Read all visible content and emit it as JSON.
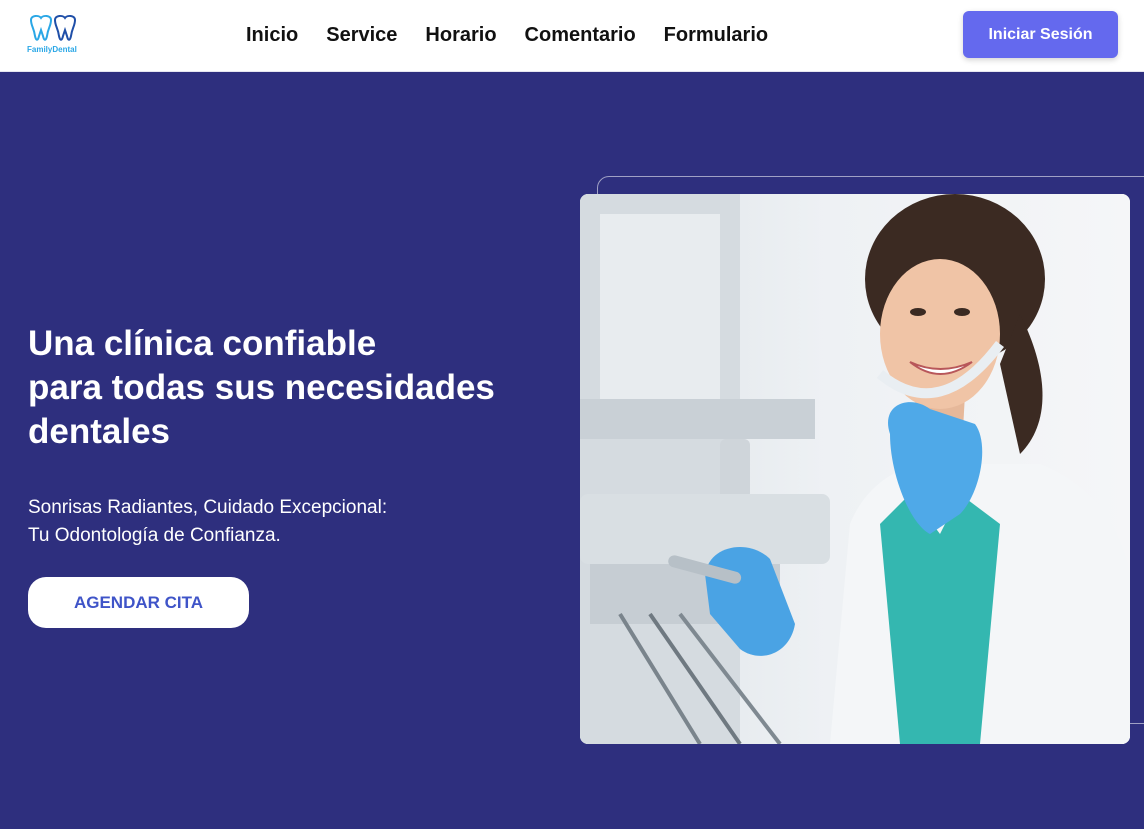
{
  "header": {
    "logo_text": "FamilyDental",
    "nav": [
      {
        "label": "Inicio"
      },
      {
        "label": "Service"
      },
      {
        "label": "Horario"
      },
      {
        "label": "Comentario"
      },
      {
        "label": "Formulario"
      }
    ],
    "login_label": "Iniciar Sesión"
  },
  "hero": {
    "title_lines": [
      "Una clínica confiable",
      "para todas sus necesidades",
      "dentales"
    ],
    "subtitle_lines": [
      "Sonrisas Radiantes, Cuidado Excepcional:",
      "Tu Odontología de Confianza."
    ],
    "cta_label": "AGENDAR CITA",
    "image_alt": "Dentista sonriente con guantes azules sosteniendo instrumento dental"
  },
  "colors": {
    "hero_background": "#2e2f7e",
    "login_button": "#6469ee",
    "cta_text": "#3f54c8",
    "logo_accent": "#2aa7e6"
  },
  "icons": {
    "logo": "tooth-logo-icon"
  }
}
